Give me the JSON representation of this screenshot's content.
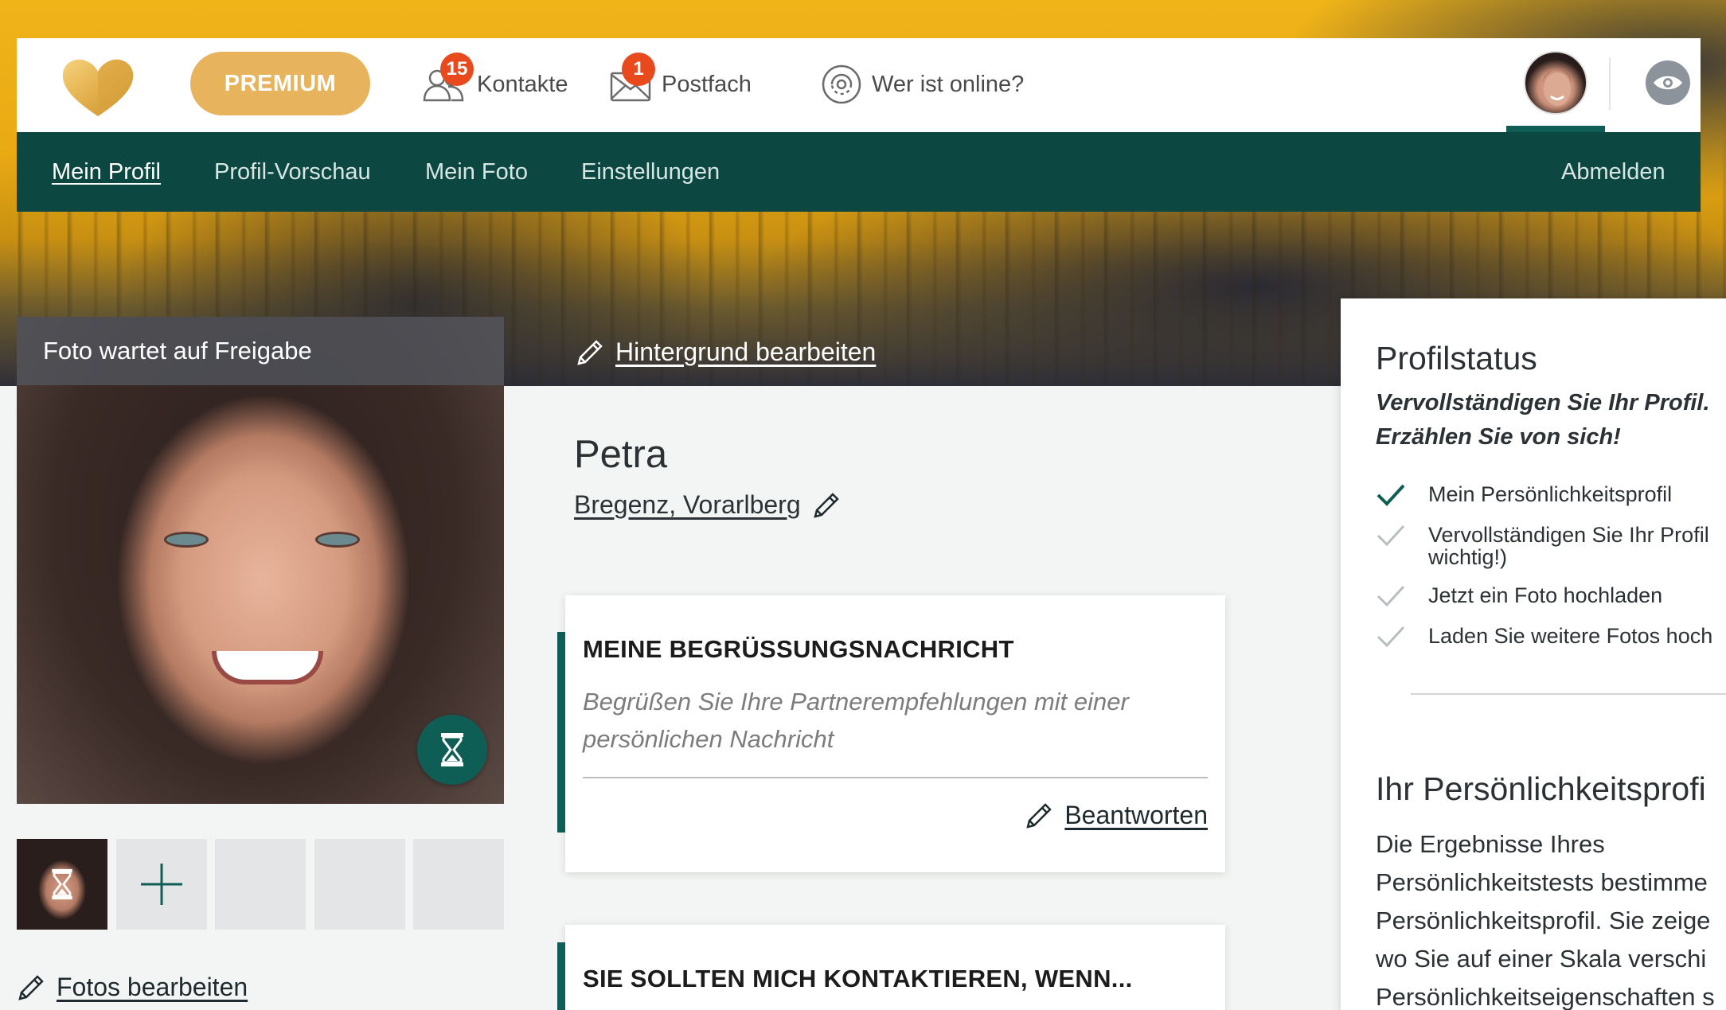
{
  "topbar": {
    "premium_label": "PREMIUM",
    "contacts": {
      "label": "Kontakte",
      "badge": "15"
    },
    "mailbox": {
      "label": "Postfach",
      "badge": "1"
    },
    "online_label": "Wer ist online?"
  },
  "subnav": {
    "items": [
      {
        "label": "Mein Profil",
        "active": true
      },
      {
        "label": "Profil-Vorschau"
      },
      {
        "label": "Mein Foto"
      },
      {
        "label": "Einstellungen"
      }
    ],
    "logout_label": "Abmelden"
  },
  "photo": {
    "status_banner": "Foto wartet auf Freigabe",
    "edit_photos_label": "Fotos bearbeiten"
  },
  "profile": {
    "edit_background_label": "Hintergrund bearbeiten",
    "name": "Petra",
    "location": "Bregenz, Vorarlberg"
  },
  "greeting_card": {
    "title": "MEINE BEGRÜSSUNGSNACHRICHT",
    "description": "Begrüßen Sie Ihre Partnerempfehlungen mit einer persönlichen Nachricht",
    "answer_label": "Beantworten"
  },
  "contact_card": {
    "title": "SIE SOLLTEN MICH KONTAKTIEREN, WENN..."
  },
  "profile_status": {
    "title": "Profilstatus",
    "subtitle_line1": "Vervollständigen Sie Ihr Profil.",
    "subtitle_line2": "Erzählen Sie von sich!",
    "items": [
      {
        "label": "Mein Persönlichkeitsprofil",
        "done": true
      },
      {
        "label": "Vervollständigen Sie Ihr Profil",
        "label2": "wichtig!)",
        "done": false
      },
      {
        "label": "Jetzt ein Foto hochladen",
        "done": false
      },
      {
        "label": "Laden Sie weitere Fotos hoch",
        "done": false
      }
    ]
  },
  "personality": {
    "title": "Ihr Persönlichkeitsprofi",
    "lines": [
      "Die Ergebnisse Ihres",
      "Persönlichkeitstests bestimme",
      "Persönlichkeitsprofil. Sie zeige",
      "wo Sie auf einer Skala verschi",
      "Persönlichkeitseigenschaften s"
    ]
  },
  "colors": {
    "brand_green": "#0d4741",
    "accent_green": "#0f5e56",
    "premium_gold": "#e7b35c",
    "badge_red": "#e84a1e"
  }
}
